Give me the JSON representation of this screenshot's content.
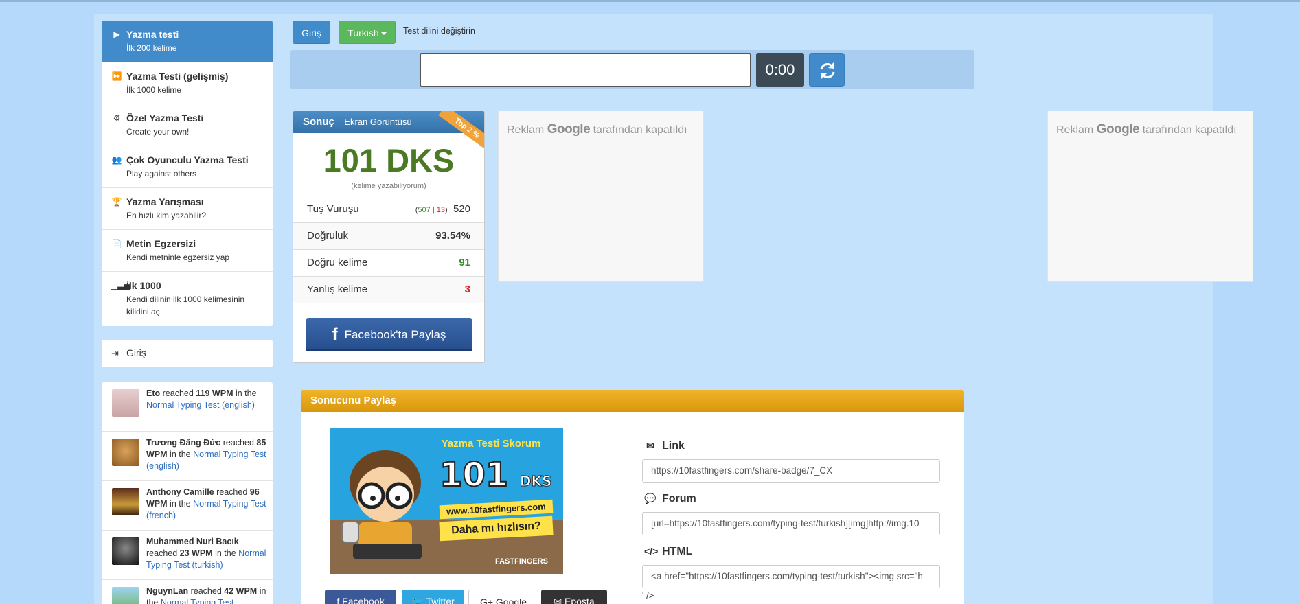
{
  "nav": {
    "items": [
      {
        "title": "Yazma testi",
        "sub": "İlk 200 kelime"
      },
      {
        "title": "Yazma Testi (gelişmiş)",
        "sub": "İlk 1000 kelime"
      },
      {
        "title": "Özel Yazma Testi",
        "sub": "Create your own!"
      },
      {
        "title": "Çok Oyunculu Yazma Testi",
        "sub": "Play against others"
      },
      {
        "title": "Yazma Yarışması",
        "sub": "En hızlı kim yazabilir?"
      },
      {
        "title": "Metin Egzersizi",
        "sub": "Kendi metninle egzersiz yap"
      },
      {
        "title": "İlk 1000",
        "sub": "Kendi dilinin ilk 1000 kelimesinin kilidini aç"
      }
    ]
  },
  "login_box": {
    "label": "Giriş"
  },
  "feed": [
    {
      "name": "Eto",
      "mid": "reached",
      "wpm": "119 WPM",
      "in": "in the",
      "link": "Normal Typing Test (english)"
    },
    {
      "name": "Trương Đăng Đức",
      "mid": "reached",
      "wpm": "85 WPM",
      "in": "in the",
      "link": "Normal Typing Test (english)"
    },
    {
      "name": "Anthony Camille",
      "mid": "reached",
      "wpm": "96 WPM",
      "in": "in the",
      "link": "Normal Typing Test (french)"
    },
    {
      "name": "Muhammed Nuri Bacık",
      "mid": "reached",
      "wpm": "23 WPM",
      "in": "in the",
      "link": "Normal Typing Test (turkish)"
    },
    {
      "name": "NguynLan",
      "mid": "reached",
      "wpm": "42 WPM",
      "in": "in the",
      "link": "Normal Typing Test"
    }
  ],
  "topbar": {
    "login_label": "Giriş",
    "language_label": "Turkish",
    "language_hint": "Test dilini değiştirin",
    "timer": "0:00"
  },
  "result": {
    "tab_result": "Sonuç",
    "tab_screenshot": "Ekran Görüntüsü",
    "ribbon": "Top 2 %",
    "wpm": "101 DKS",
    "wpm_sub": "(kelime yazabiliyorum)",
    "rows": [
      {
        "label": "Tuş Vuruşu",
        "correct": "507",
        "sep": "|",
        "wrong": "13",
        "total": "520"
      },
      {
        "label": "Doğruluk",
        "value": "93.54%"
      },
      {
        "label": "Doğru kelime",
        "value": "91"
      },
      {
        "label": "Yanlış kelime",
        "value": "3"
      }
    ],
    "facebook_share": "Facebook'ta Paylaş"
  },
  "ads": [
    {
      "prefix": "Reklam",
      "brand": "Google",
      "suffix": "tarafından kapatıldı"
    },
    {
      "prefix": "Reklam",
      "brand": "Google",
      "suffix": "tarafından kapatıldı"
    }
  ],
  "share": {
    "title": "Sonucunu Paylaş",
    "badge": {
      "heading": "Yazma Testi Skorum",
      "score": "101",
      "unit": "DKS",
      "site": "www.10fastfingers.com",
      "cta": "Daha mı hızlısın?",
      "brand": "FASTFINGERS"
    },
    "buttons": [
      {
        "label": "Facebook",
        "color": "#3b5998"
      },
      {
        "label": "Twitter",
        "color": "#2ea7e0"
      },
      {
        "label": "Google",
        "color": "#ffffff"
      },
      {
        "label": "Eposta",
        "color": "#333333"
      }
    ],
    "link_label": "Link",
    "link_value": "https://10fastfingers.com/share-badge/7_CX",
    "forum_label": "Forum",
    "forum_value": "[url=https://10fastfingers.com/typing-test/turkish][img]http://img.10",
    "html_label": "HTML",
    "html_value": "<a href=\"https://10fastfingers.com/typing-test/turkish\"><img src=\"h",
    "html_tail": "' />"
  },
  "colors": {
    "accent": "#428bca",
    "success": "#5cb85c",
    "wpm_green": "#4a7a23",
    "wrong_red": "#d9261c"
  }
}
